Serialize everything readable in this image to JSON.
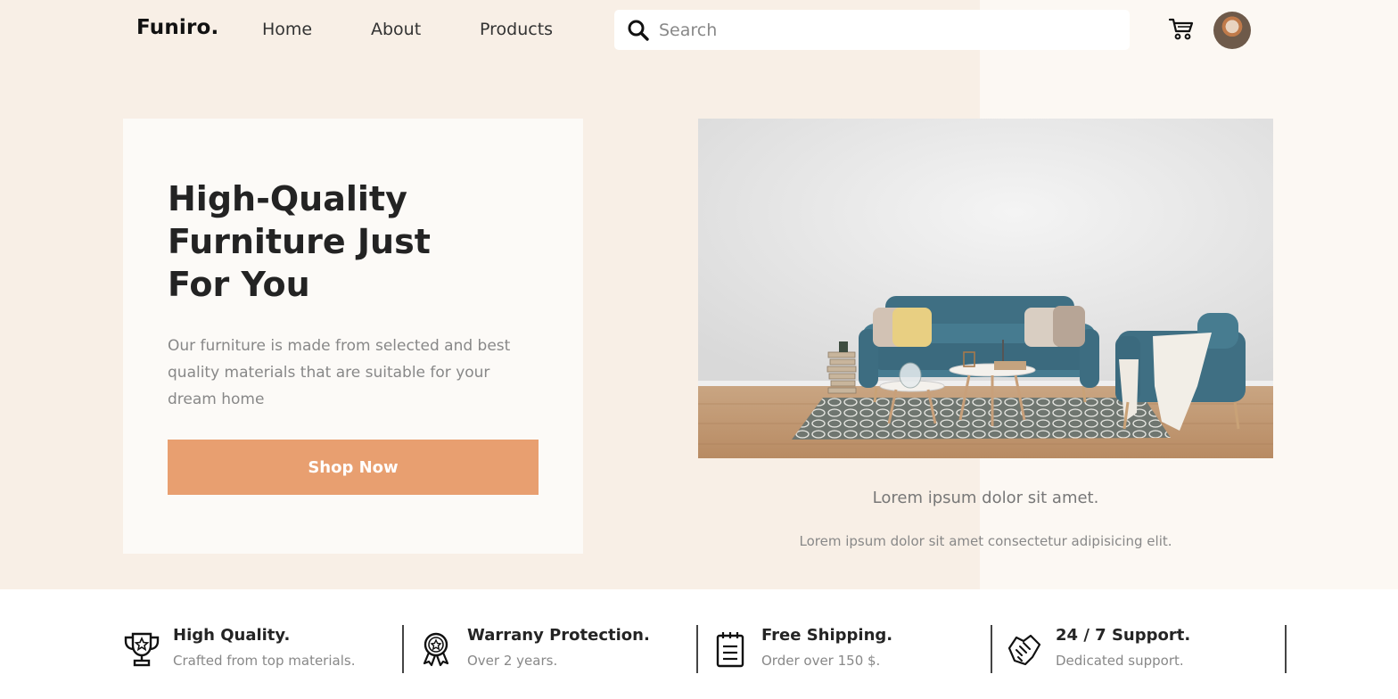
{
  "brand": {
    "logo": "Funiro."
  },
  "nav": {
    "home": "Home",
    "about": "About",
    "products": "Products"
  },
  "search": {
    "placeholder": "Search"
  },
  "hero": {
    "title_line1": "High-Quality",
    "title_line2": "Furniture Just",
    "title_line3": "For You",
    "description": "Our furniture is made from selected and best quality materials that are suitable for your dream home",
    "cta": "Shop Now"
  },
  "showcase": {
    "caption": "Lorem ipsum dolor sit amet.",
    "subcaption": "Lorem ipsum dolor sit amet consectetur adipisicing elit."
  },
  "features": [
    {
      "title": "High Quality.",
      "subtitle": "Crafted from top materials.",
      "icon": "trophy-icon"
    },
    {
      "title": "Warrany Protection.",
      "subtitle": "Over 2 years.",
      "icon": "badge-icon"
    },
    {
      "title": "Free Shipping.",
      "subtitle": "Order over 150 $.",
      "icon": "clipboard-icon"
    },
    {
      "title": "24 / 7 Support.",
      "subtitle": "Dedicated support.",
      "icon": "handshake-icon"
    }
  ],
  "colors": {
    "accent": "#e89f70",
    "hero_bg": "#f8efe6",
    "card_bg": "#fcfaf7"
  }
}
